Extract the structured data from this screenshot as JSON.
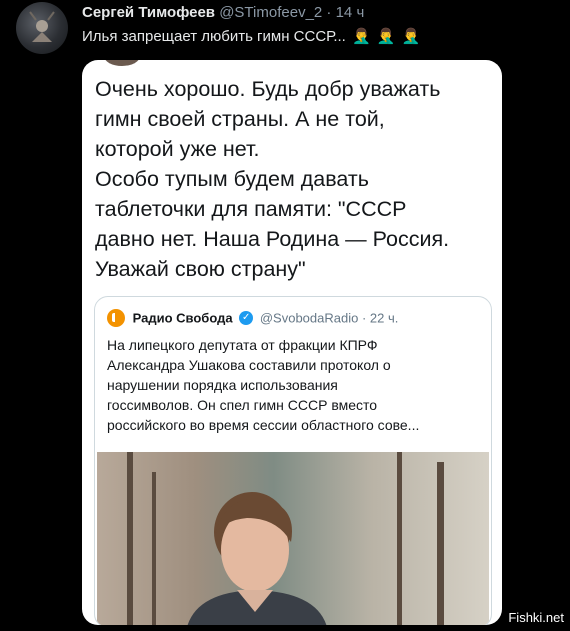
{
  "tweet": {
    "author": "Сергей Тимофеев",
    "handle": "@STimofeev_2",
    "separator": "·",
    "time": "14 ч",
    "text": "Илья запрещает любить гимн СССР...",
    "emoji": [
      "🤦‍♂️",
      "🤦‍♂️",
      "🤦‍♂️"
    ]
  },
  "card": {
    "text": "Очень хорошо. Будь добр уважать\nгимн своей страны. А не той,\nкоторой уже нет.\nОсобо тупым будем давать\nтаблеточки для памяти: \"СССР\nдавно нет. Наша Родина — Россия.\nУважай свою страну\""
  },
  "quote": {
    "name": "Радио Свобода",
    "handle": "@SvobodaRadio",
    "separator": "·",
    "time": "22 ч.",
    "text": "На липецкого депутата от фракции КПРФ\nАлександра Ушакова составили протокол о\nнарушении порядка использования\nгоссимволов. Он спел гимн СССР вместо\nроссийского во время сессии областного сове..."
  },
  "watermark": "Fishki.net",
  "icons": {
    "avatar": "profile-avatar",
    "verified": "verified-badge-icon",
    "logo": "radio-svoboda-logo-icon"
  }
}
